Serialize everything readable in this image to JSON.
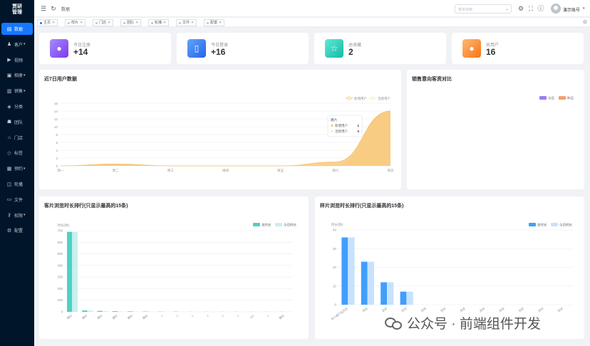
{
  "logo": {
    "line1": "贾研",
    "line2": "管理"
  },
  "sidebar": {
    "items": [
      {
        "label": "数据",
        "icon": "chart-icon",
        "caret": false,
        "active": true
      },
      {
        "label": "客户",
        "icon": "user-icon",
        "caret": true
      },
      {
        "label": "视频",
        "icon": "video-icon",
        "caret": false
      },
      {
        "label": "相册",
        "icon": "image-icon",
        "caret": true
      },
      {
        "label": "销售",
        "icon": "bar-chart-icon",
        "caret": true
      },
      {
        "label": "分类",
        "icon": "tag-icon",
        "caret": false
      },
      {
        "label": "团队",
        "icon": "team-icon",
        "caret": false
      },
      {
        "label": "门店",
        "icon": "store-icon",
        "caret": false
      },
      {
        "label": "标签",
        "icon": "label-icon",
        "caret": false
      },
      {
        "label": "预约",
        "icon": "calendar-icon",
        "caret": true
      },
      {
        "label": "轮播",
        "icon": "carousel-icon",
        "caret": false
      },
      {
        "label": "文件",
        "icon": "file-icon",
        "caret": false
      },
      {
        "label": "权限",
        "icon": "lock-icon",
        "caret": true
      },
      {
        "label": "配置",
        "icon": "gear-icon",
        "caret": false
      }
    ]
  },
  "header": {
    "breadcrumb": "数据",
    "search_placeholder": "菜单搜索",
    "user_name": "演示账号"
  },
  "tabs": [
    {
      "label": "主页",
      "active": true
    },
    {
      "label": "样片"
    },
    {
      "label": "门店"
    },
    {
      "label": "团队"
    },
    {
      "label": "轮播"
    },
    {
      "label": "文件"
    },
    {
      "label": "配置"
    }
  ],
  "stats": [
    {
      "label": "今日注册",
      "value": "+14",
      "icon": "user-icon",
      "color_from": "#a78bfa",
      "color_to": "#7c3aed"
    },
    {
      "label": "今日登录",
      "value": "+16",
      "icon": "login-icon",
      "color_from": "#60a5fa",
      "color_to": "#2563eb"
    },
    {
      "label": "总收藏",
      "value": "2",
      "icon": "star-icon",
      "color_from": "#5eead4",
      "color_to": "#14b8a6"
    },
    {
      "label": "总用户",
      "value": "16",
      "icon": "user-icon",
      "color_from": "#fdba74",
      "color_to": "#f97316"
    }
  ],
  "user_chart": {
    "title": "近7日用户数据",
    "tooltip": {
      "title": "周六",
      "rows": [
        {
          "name": "新增用户",
          "value": "1"
        },
        {
          "name": "活跃用户",
          "value": "0"
        }
      ]
    }
  },
  "sales_chart": {
    "title": "销售意向客资对比",
    "legend": [
      "今日",
      "昨日"
    ],
    "legend_colors": [
      "#9c7cf4",
      "#f5a06b"
    ]
  },
  "bar_chart_1": {
    "title": "客片浏览时长排行(只显示最高的15条)",
    "unit_label": "时长(秒)"
  },
  "bar_chart_2": {
    "title": "样片浏览时长排行(只显示最高的15条)",
    "unit_label": "时长(秒)"
  },
  "chart_data": [
    {
      "type": "area",
      "categories": [
        "周一",
        "周二",
        "周三",
        "周四",
        "周五",
        "周六",
        "周日"
      ],
      "series": [
        {
          "name": "新增用户",
          "values": [
            0,
            0.5,
            0,
            0,
            0,
            1,
            14
          ],
          "color": "#f5c26b"
        },
        {
          "name": "活跃用户",
          "values": [
            0,
            0.3,
            0,
            0,
            0,
            0,
            14
          ],
          "color": "#fde2b3"
        }
      ],
      "ylim": [
        0,
        16
      ],
      "yticks": [
        0,
        2,
        4,
        6,
        8,
        10,
        12,
        14,
        16
      ],
      "legend": "top-right"
    },
    {
      "type": "bar",
      "categories": [
        "婚纱",
        "婚纱",
        "婚纱",
        "婚纱",
        "婚纱",
        "婚纱",
        "1",
        "1",
        "1",
        "1",
        "1",
        "1",
        "111",
        "1",
        "婚纱"
      ],
      "series": [
        {
          "name": "总时长",
          "values": [
            690,
            12,
            8,
            6,
            4,
            3,
            2,
            2,
            1,
            1,
            1,
            1,
            1,
            1,
            1
          ],
          "color": "#4fd1c5"
        },
        {
          "name": "今日时长",
          "values": [
            690,
            10,
            6,
            4,
            3,
            2,
            1,
            1,
            1,
            1,
            1,
            1,
            1,
            1,
            1
          ],
          "color": "#c8f0ee"
        }
      ],
      "ylim": [
        0,
        700
      ],
      "yticks": [
        0,
        100,
        200,
        300,
        400,
        500,
        600,
        700
      ],
      "ylabel": "时长(秒)",
      "legend": "top-right"
    },
    {
      "type": "bar",
      "categories": [
        "多小姐产品先生",
        "测试",
        "测试",
        "测试",
        "测试",
        "测试",
        "测试",
        "测试",
        "测试",
        "测试",
        "测试",
        "测试"
      ],
      "series": [
        {
          "name": "总时长",
          "values": [
            36,
            23,
            12,
            7,
            0,
            0,
            0,
            0,
            0,
            0,
            0,
            0
          ],
          "color": "#409eff"
        },
        {
          "name": "今日时长",
          "values": [
            36,
            23,
            12,
            7,
            0,
            0,
            0,
            0,
            0,
            0,
            0,
            0
          ],
          "color": "#c6e2ff"
        }
      ],
      "ylim": [
        0,
        40
      ],
      "yticks": [
        0,
        10,
        20,
        30,
        40
      ],
      "ylabel": "时长(秒)",
      "legend": "top-right"
    }
  ],
  "watermark": "公众号 · 前端组件开发"
}
